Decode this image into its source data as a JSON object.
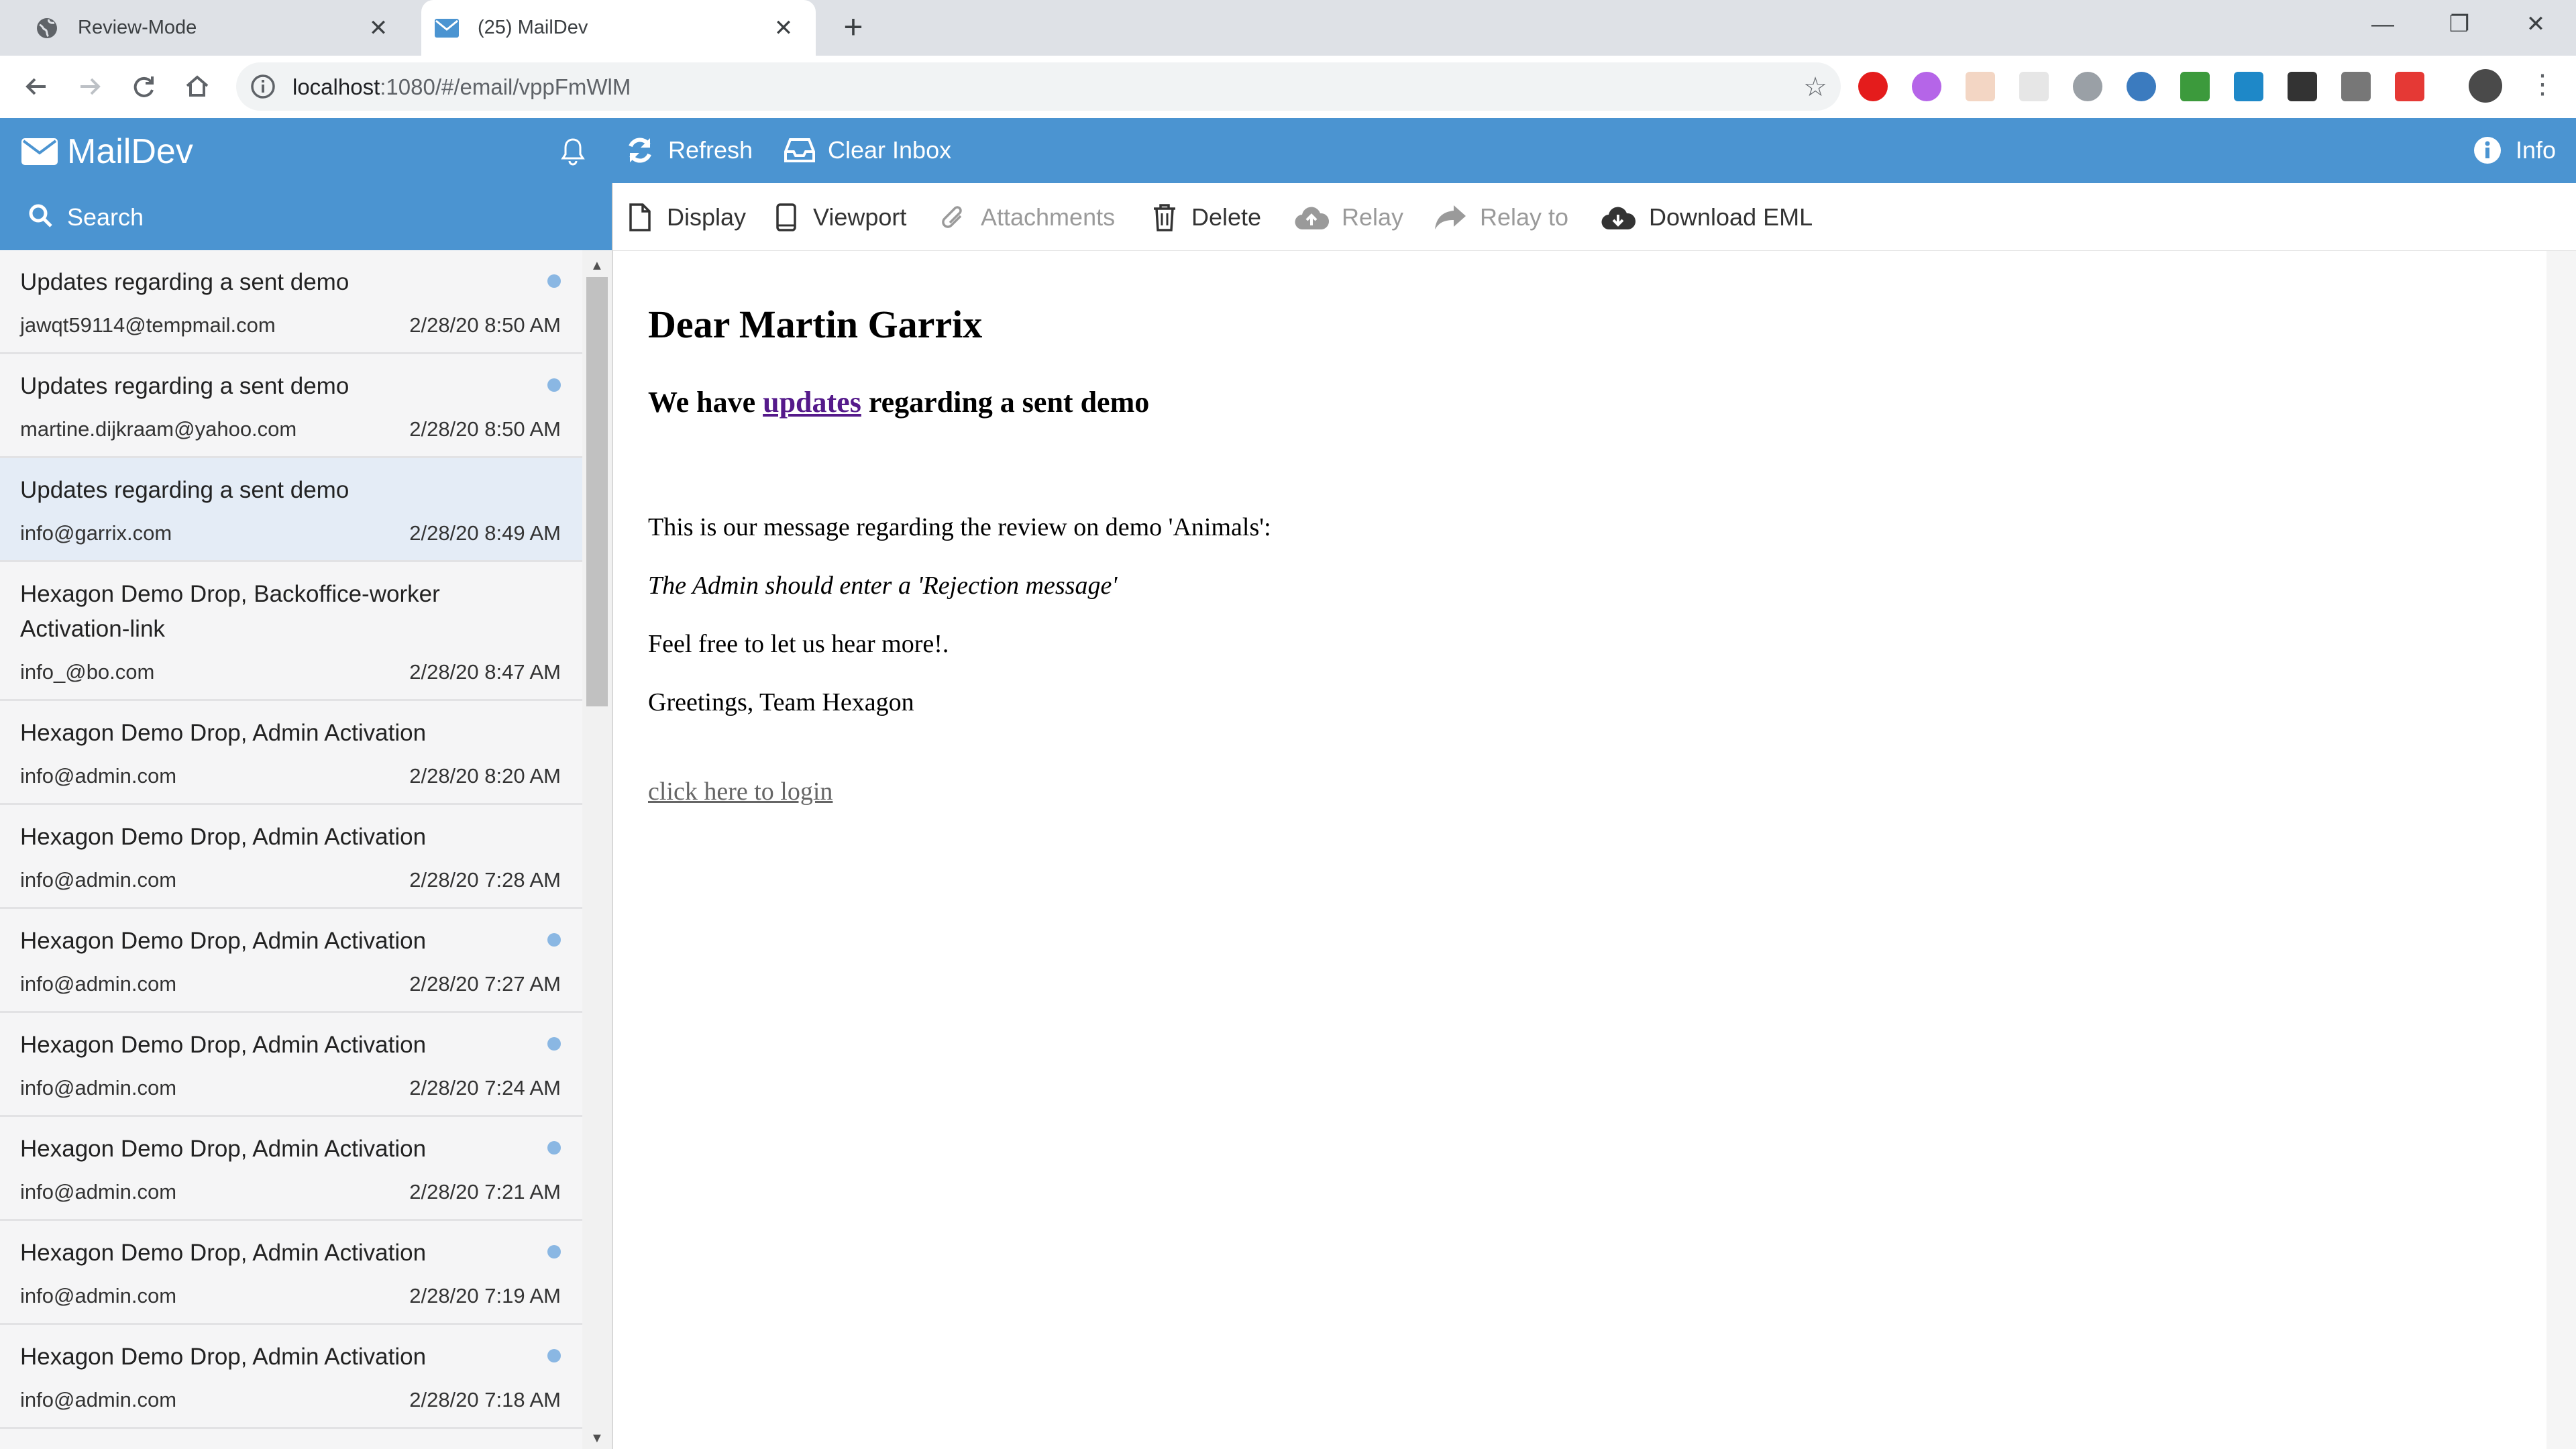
{
  "browser": {
    "tabs": [
      {
        "title": "Review-Mode",
        "active": false
      },
      {
        "title": "(25) MailDev",
        "active": true
      }
    ],
    "url_host": "localhost",
    "url_path": ":1080/#/email/vppFmWlM"
  },
  "app": {
    "brand": "MailDev",
    "header_buttons": {
      "refresh": "Refresh",
      "clear_inbox": "Clear Inbox",
      "info": "Info"
    },
    "search_label": "Search",
    "accent_color": "#4b94d1"
  },
  "email_list": [
    {
      "subject": "Updates regarding a sent demo",
      "from": "jawqt59114@tempmail.com",
      "time": "2/28/20 8:50 AM",
      "unread": true
    },
    {
      "subject": "Updates regarding a sent demo",
      "from": "martine.dijkraam@yahoo.com",
      "time": "2/28/20 8:50 AM",
      "unread": true
    },
    {
      "subject": "Updates regarding a sent demo",
      "from": "info@garrix.com",
      "time": "2/28/20 8:49 AM",
      "unread": false,
      "selected": true
    },
    {
      "subject": "Hexagon Demo Drop, Backoffice-worker Activation-link",
      "from": "info_@bo.com",
      "time": "2/28/20 8:47 AM",
      "unread": false
    },
    {
      "subject": "Hexagon Demo Drop, Admin Activation",
      "from": "info@admin.com",
      "time": "2/28/20 8:20 AM",
      "unread": false
    },
    {
      "subject": "Hexagon Demo Drop, Admin Activation",
      "from": "info@admin.com",
      "time": "2/28/20 7:28 AM",
      "unread": false
    },
    {
      "subject": "Hexagon Demo Drop, Admin Activation",
      "from": "info@admin.com",
      "time": "2/28/20 7:27 AM",
      "unread": true
    },
    {
      "subject": "Hexagon Demo Drop, Admin Activation",
      "from": "info@admin.com",
      "time": "2/28/20 7:24 AM",
      "unread": true
    },
    {
      "subject": "Hexagon Demo Drop, Admin Activation",
      "from": "info@admin.com",
      "time": "2/28/20 7:21 AM",
      "unread": true
    },
    {
      "subject": "Hexagon Demo Drop, Admin Activation",
      "from": "info@admin.com",
      "time": "2/28/20 7:19 AM",
      "unread": true
    },
    {
      "subject": "Hexagon Demo Drop, Admin Activation",
      "from": "info@admin.com",
      "time": "2/28/20 7:18 AM",
      "unread": true
    }
  ],
  "actions": {
    "display": "Display",
    "viewport": "Viewport",
    "attachments": "Attachments",
    "delete": "Delete",
    "relay": "Relay",
    "relay_to": "Relay to",
    "download": "Download EML"
  },
  "message": {
    "heading": "Dear Martin Garrix",
    "sub_before": "We have ",
    "sub_link": "updates",
    "sub_after": " regarding a sent demo",
    "line1": "This is our message regarding the review on demo 'Animals':",
    "line2": "The Admin should enter a 'Rejection message'",
    "line3": "Feel free to let us hear more!.",
    "line4": "Greetings, Team Hexagon",
    "login_link": "click here to login"
  }
}
